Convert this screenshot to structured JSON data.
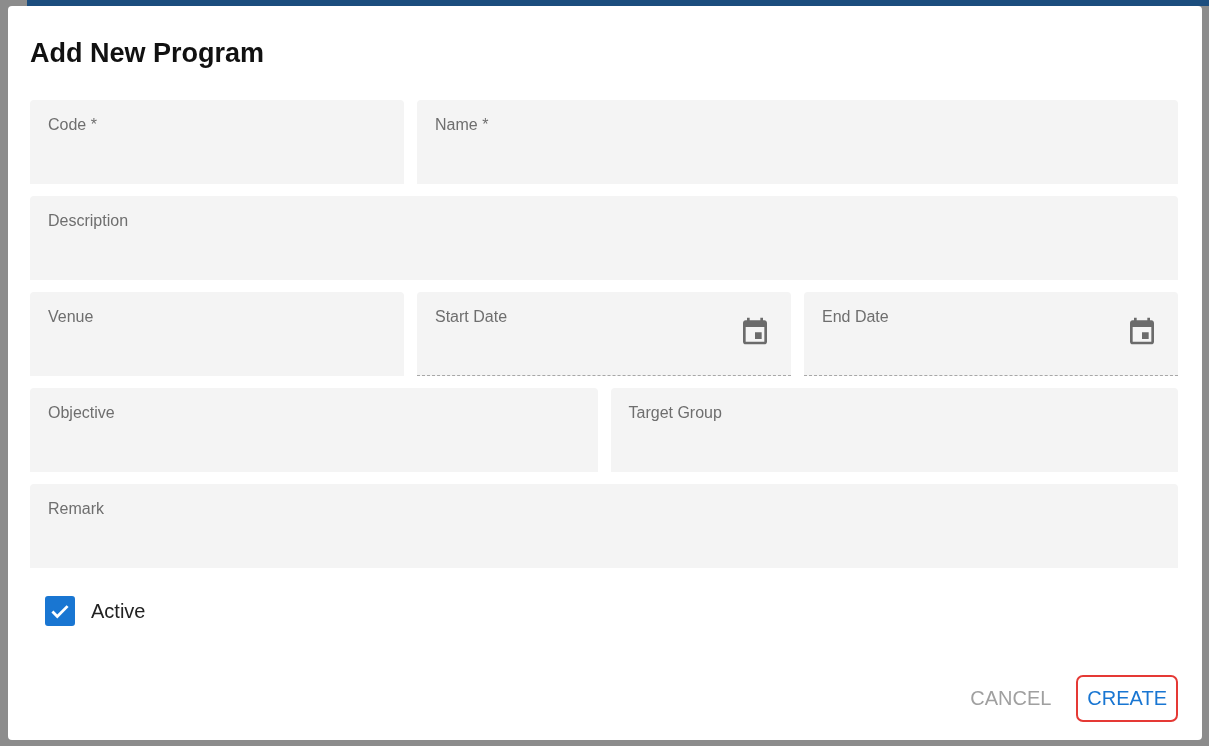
{
  "dialog": {
    "title": "Add New Program"
  },
  "fields": [
    {
      "label": "Code *",
      "kind": "text"
    },
    {
      "label": "Name *",
      "kind": "text"
    },
    {
      "label": "Description",
      "kind": "text"
    },
    {
      "label": "Venue",
      "kind": "text"
    },
    {
      "label": "Start Date",
      "kind": "date"
    },
    {
      "label": "End Date",
      "kind": "date"
    },
    {
      "label": "Objective",
      "kind": "text"
    },
    {
      "label": "Target Group",
      "kind": "text"
    },
    {
      "label": "Remark",
      "kind": "text"
    }
  ],
  "active": {
    "label": "Active",
    "checked": true
  },
  "buttons": [
    {
      "label": "CANCEL",
      "kind": "secondary",
      "highlighted": false
    },
    {
      "label": "CREATE",
      "kind": "primary",
      "highlighted": true
    }
  ]
}
